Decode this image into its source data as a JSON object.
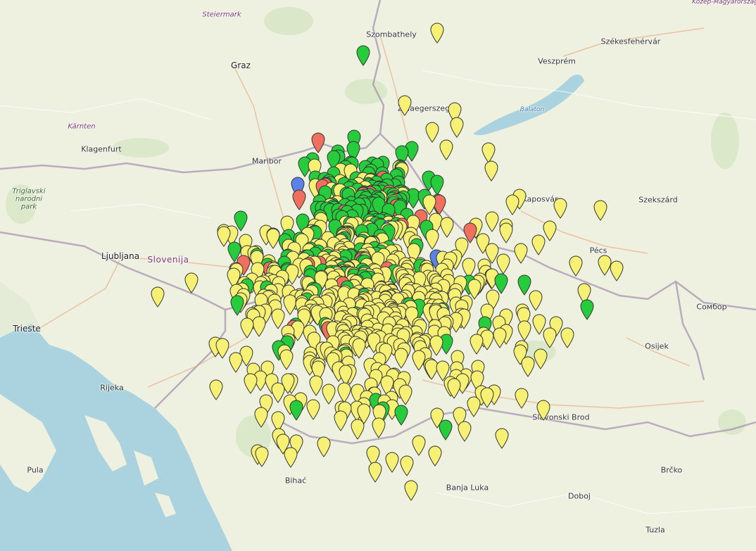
{
  "map": {
    "labels": [
      {
        "id": "steiermark",
        "text": "Steiermark",
        "kind": "region"
      },
      {
        "id": "szombathely",
        "text": "Szombathely",
        "kind": "town"
      },
      {
        "id": "szekesfehervar",
        "text": "Székesfehérvár",
        "kind": "town"
      },
      {
        "id": "graz",
        "text": "Graz",
        "kind": "city"
      },
      {
        "id": "veszprem",
        "text": "Veszprém",
        "kind": "town"
      },
      {
        "id": "balaton",
        "text": "Balaton",
        "kind": "water"
      },
      {
        "id": "zalaegerszeg",
        "text": "Zalaegerszeg",
        "kind": "town"
      },
      {
        "id": "karnten",
        "text": "Kärnten",
        "kind": "region"
      },
      {
        "id": "klagenfurt",
        "text": "Klagenfurt",
        "kind": "town"
      },
      {
        "id": "maribor",
        "text": "Maribor",
        "kind": "town"
      },
      {
        "id": "kaposvar",
        "text": "Kaposvár",
        "kind": "town"
      },
      {
        "id": "szekszard",
        "text": "Szekszárd",
        "kind": "town"
      },
      {
        "id": "triglav",
        "text": "Triglavski narodni park",
        "kind": "park"
      },
      {
        "id": "ljubljana",
        "text": "Ljubljana",
        "kind": "city"
      },
      {
        "id": "slovenija",
        "text": "Slovenija",
        "kind": "country"
      },
      {
        "id": "pecs",
        "text": "Pécs",
        "kind": "town"
      },
      {
        "id": "trieste",
        "text": "Trieste",
        "kind": "city"
      },
      {
        "id": "sombor",
        "text": "Сомбор",
        "kind": "town"
      },
      {
        "id": "osijek",
        "text": "Osijek",
        "kind": "town"
      },
      {
        "id": "rijeka",
        "text": "Rijeka",
        "kind": "town"
      },
      {
        "id": "slavonski_brod",
        "text": "Slavonski Brod",
        "kind": "town"
      },
      {
        "id": "pula",
        "text": "Pula",
        "kind": "town"
      },
      {
        "id": "bihac",
        "text": "Bihać",
        "kind": "town"
      },
      {
        "id": "banja_luka",
        "text": "Banja Luka",
        "kind": "town"
      },
      {
        "id": "brcko",
        "text": "Brčko",
        "kind": "town"
      },
      {
        "id": "doboj",
        "text": "Doboj",
        "kind": "town"
      },
      {
        "id": "tuzla",
        "text": "Tuzla",
        "kind": "town"
      },
      {
        "id": "top_right",
        "text": "Közép-Magyarország",
        "kind": "region"
      }
    ],
    "marker_colors": {
      "yellow": "#f6f075",
      "green": "#27cc3c",
      "red": "#f07060",
      "blue": "#5b82e8"
    },
    "marker_icon": "map-pin-icon"
  }
}
